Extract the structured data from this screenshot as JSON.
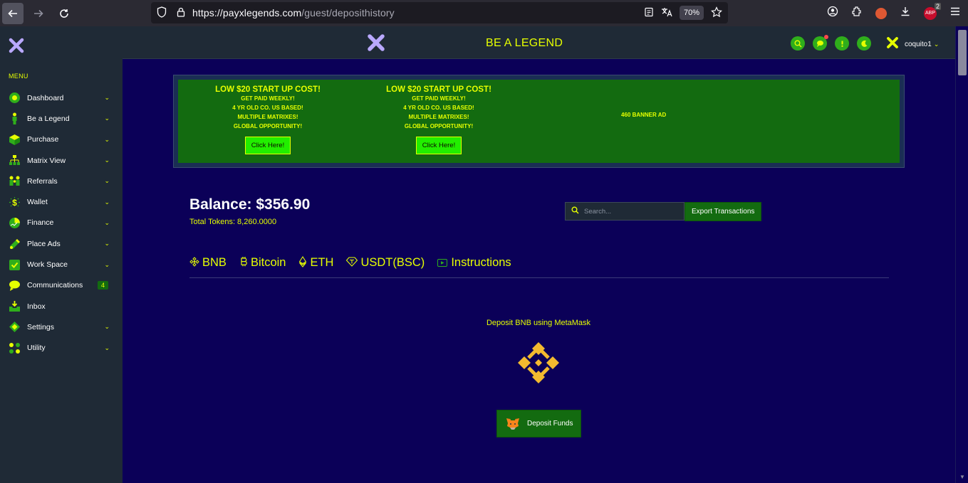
{
  "browser": {
    "url_main": "https://payxlegends.com",
    "url_path": "/guest/deposithistory",
    "zoom": "70%",
    "adblock_count": "2",
    "adblock_label": "ABP"
  },
  "sidebar": {
    "menu_title": "MENU",
    "items": [
      {
        "label": "Dashboard",
        "icon": "dashboard-icon",
        "chevron": "⌄"
      },
      {
        "label": "Be a Legend",
        "icon": "person-icon",
        "chevron": "⌄"
      },
      {
        "label": "Purchase",
        "icon": "box-icon",
        "chevron": "⌄"
      },
      {
        "label": "Matrix View",
        "icon": "matrix-icon",
        "chevron": "⌄"
      },
      {
        "label": "Referrals",
        "icon": "referrals-icon",
        "chevron": "⌄"
      },
      {
        "label": "Wallet",
        "icon": "wallet-icon",
        "chevron": "⌄"
      },
      {
        "label": "Finance",
        "icon": "finance-icon",
        "chevron": "⌄"
      },
      {
        "label": "Place Ads",
        "icon": "ads-icon",
        "chevron": "⌄"
      },
      {
        "label": "Work Space",
        "icon": "workspace-icon",
        "chevron": "⌄"
      },
      {
        "label": "Communications",
        "icon": "chat-icon",
        "badge": "4"
      },
      {
        "label": "Inbox",
        "icon": "inbox-icon"
      },
      {
        "label": "Settings",
        "icon": "settings-icon",
        "chevron": "⌄"
      },
      {
        "label": "Utility",
        "icon": "utility-icon",
        "chevron": "⌄"
      }
    ]
  },
  "header": {
    "slogan": "BE A LEGEND",
    "username": "coquito1"
  },
  "banner": {
    "ads": [
      {
        "title": "LOW $20 START UP COST!",
        "lines": [
          "GET PAID WEEKLY!",
          "4 YR OLD CO. US BASED!",
          "MULTIPLE MATRIXES!",
          "GLOBAL OPPORTUNITY!"
        ],
        "button": "Click Here!"
      },
      {
        "title": "LOW $20 START UP COST!",
        "lines": [
          "GET PAID WEEKLY!",
          "4 YR OLD CO. US BASED!",
          "MULTIPLE MATRIXES!",
          "GLOBAL OPPORTUNITY!"
        ],
        "button": "Click Here!"
      }
    ],
    "placeholder_ad": "460 BANNER AD"
  },
  "account": {
    "balance": "Balance: $356.90",
    "tokens": "Total Tokens: 8,260.0000"
  },
  "search": {
    "placeholder": "Search..."
  },
  "export_label": "Export Transactions",
  "tabs": [
    {
      "label": "BNB",
      "icon": "bnb-icon"
    },
    {
      "label": "Bitcoin",
      "icon": "bitcoin-icon"
    },
    {
      "label": "ETH",
      "icon": "eth-icon"
    },
    {
      "label": "USDT(BSC)",
      "icon": "usdt-icon"
    },
    {
      "label": "Instructions",
      "icon": "video-icon"
    }
  ],
  "deposit": {
    "title": "Deposit BNB using MetaMask",
    "button": "Deposit Funds"
  },
  "colors": {
    "accent": "#e6ff00",
    "green": "#136b10",
    "bright_green": "#22ee00",
    "bg": "#0b0058",
    "panel": "#1f2a36",
    "bnb": "#f3ba2f"
  }
}
